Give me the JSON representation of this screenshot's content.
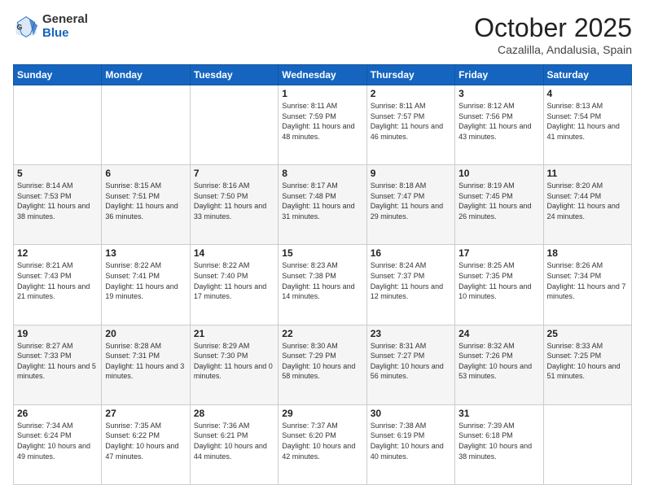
{
  "header": {
    "logo_general": "General",
    "logo_blue": "Blue",
    "month_title": "October 2025",
    "location": "Cazalilla, Andalusia, Spain"
  },
  "weekdays": [
    "Sunday",
    "Monday",
    "Tuesday",
    "Wednesday",
    "Thursday",
    "Friday",
    "Saturday"
  ],
  "weeks": [
    [
      {
        "day": "",
        "sunrise": "",
        "sunset": "",
        "daylight": ""
      },
      {
        "day": "",
        "sunrise": "",
        "sunset": "",
        "daylight": ""
      },
      {
        "day": "",
        "sunrise": "",
        "sunset": "",
        "daylight": ""
      },
      {
        "day": "1",
        "sunrise": "Sunrise: 8:11 AM",
        "sunset": "Sunset: 7:59 PM",
        "daylight": "Daylight: 11 hours and 48 minutes."
      },
      {
        "day": "2",
        "sunrise": "Sunrise: 8:11 AM",
        "sunset": "Sunset: 7:57 PM",
        "daylight": "Daylight: 11 hours and 46 minutes."
      },
      {
        "day": "3",
        "sunrise": "Sunrise: 8:12 AM",
        "sunset": "Sunset: 7:56 PM",
        "daylight": "Daylight: 11 hours and 43 minutes."
      },
      {
        "day": "4",
        "sunrise": "Sunrise: 8:13 AM",
        "sunset": "Sunset: 7:54 PM",
        "daylight": "Daylight: 11 hours and 41 minutes."
      }
    ],
    [
      {
        "day": "5",
        "sunrise": "Sunrise: 8:14 AM",
        "sunset": "Sunset: 7:53 PM",
        "daylight": "Daylight: 11 hours and 38 minutes."
      },
      {
        "day": "6",
        "sunrise": "Sunrise: 8:15 AM",
        "sunset": "Sunset: 7:51 PM",
        "daylight": "Daylight: 11 hours and 36 minutes."
      },
      {
        "day": "7",
        "sunrise": "Sunrise: 8:16 AM",
        "sunset": "Sunset: 7:50 PM",
        "daylight": "Daylight: 11 hours and 33 minutes."
      },
      {
        "day": "8",
        "sunrise": "Sunrise: 8:17 AM",
        "sunset": "Sunset: 7:48 PM",
        "daylight": "Daylight: 11 hours and 31 minutes."
      },
      {
        "day": "9",
        "sunrise": "Sunrise: 8:18 AM",
        "sunset": "Sunset: 7:47 PM",
        "daylight": "Daylight: 11 hours and 29 minutes."
      },
      {
        "day": "10",
        "sunrise": "Sunrise: 8:19 AM",
        "sunset": "Sunset: 7:45 PM",
        "daylight": "Daylight: 11 hours and 26 minutes."
      },
      {
        "day": "11",
        "sunrise": "Sunrise: 8:20 AM",
        "sunset": "Sunset: 7:44 PM",
        "daylight": "Daylight: 11 hours and 24 minutes."
      }
    ],
    [
      {
        "day": "12",
        "sunrise": "Sunrise: 8:21 AM",
        "sunset": "Sunset: 7:43 PM",
        "daylight": "Daylight: 11 hours and 21 minutes."
      },
      {
        "day": "13",
        "sunrise": "Sunrise: 8:22 AM",
        "sunset": "Sunset: 7:41 PM",
        "daylight": "Daylight: 11 hours and 19 minutes."
      },
      {
        "day": "14",
        "sunrise": "Sunrise: 8:22 AM",
        "sunset": "Sunset: 7:40 PM",
        "daylight": "Daylight: 11 hours and 17 minutes."
      },
      {
        "day": "15",
        "sunrise": "Sunrise: 8:23 AM",
        "sunset": "Sunset: 7:38 PM",
        "daylight": "Daylight: 11 hours and 14 minutes."
      },
      {
        "day": "16",
        "sunrise": "Sunrise: 8:24 AM",
        "sunset": "Sunset: 7:37 PM",
        "daylight": "Daylight: 11 hours and 12 minutes."
      },
      {
        "day": "17",
        "sunrise": "Sunrise: 8:25 AM",
        "sunset": "Sunset: 7:35 PM",
        "daylight": "Daylight: 11 hours and 10 minutes."
      },
      {
        "day": "18",
        "sunrise": "Sunrise: 8:26 AM",
        "sunset": "Sunset: 7:34 PM",
        "daylight": "Daylight: 11 hours and 7 minutes."
      }
    ],
    [
      {
        "day": "19",
        "sunrise": "Sunrise: 8:27 AM",
        "sunset": "Sunset: 7:33 PM",
        "daylight": "Daylight: 11 hours and 5 minutes."
      },
      {
        "day": "20",
        "sunrise": "Sunrise: 8:28 AM",
        "sunset": "Sunset: 7:31 PM",
        "daylight": "Daylight: 11 hours and 3 minutes."
      },
      {
        "day": "21",
        "sunrise": "Sunrise: 8:29 AM",
        "sunset": "Sunset: 7:30 PM",
        "daylight": "Daylight: 11 hours and 0 minutes."
      },
      {
        "day": "22",
        "sunrise": "Sunrise: 8:30 AM",
        "sunset": "Sunset: 7:29 PM",
        "daylight": "Daylight: 10 hours and 58 minutes."
      },
      {
        "day": "23",
        "sunrise": "Sunrise: 8:31 AM",
        "sunset": "Sunset: 7:27 PM",
        "daylight": "Daylight: 10 hours and 56 minutes."
      },
      {
        "day": "24",
        "sunrise": "Sunrise: 8:32 AM",
        "sunset": "Sunset: 7:26 PM",
        "daylight": "Daylight: 10 hours and 53 minutes."
      },
      {
        "day": "25",
        "sunrise": "Sunrise: 8:33 AM",
        "sunset": "Sunset: 7:25 PM",
        "daylight": "Daylight: 10 hours and 51 minutes."
      }
    ],
    [
      {
        "day": "26",
        "sunrise": "Sunrise: 7:34 AM",
        "sunset": "Sunset: 6:24 PM",
        "daylight": "Daylight: 10 hours and 49 minutes."
      },
      {
        "day": "27",
        "sunrise": "Sunrise: 7:35 AM",
        "sunset": "Sunset: 6:22 PM",
        "daylight": "Daylight: 10 hours and 47 minutes."
      },
      {
        "day": "28",
        "sunrise": "Sunrise: 7:36 AM",
        "sunset": "Sunset: 6:21 PM",
        "daylight": "Daylight: 10 hours and 44 minutes."
      },
      {
        "day": "29",
        "sunrise": "Sunrise: 7:37 AM",
        "sunset": "Sunset: 6:20 PM",
        "daylight": "Daylight: 10 hours and 42 minutes."
      },
      {
        "day": "30",
        "sunrise": "Sunrise: 7:38 AM",
        "sunset": "Sunset: 6:19 PM",
        "daylight": "Daylight: 10 hours and 40 minutes."
      },
      {
        "day": "31",
        "sunrise": "Sunrise: 7:39 AM",
        "sunset": "Sunset: 6:18 PM",
        "daylight": "Daylight: 10 hours and 38 minutes."
      },
      {
        "day": "",
        "sunrise": "",
        "sunset": "",
        "daylight": ""
      }
    ]
  ]
}
